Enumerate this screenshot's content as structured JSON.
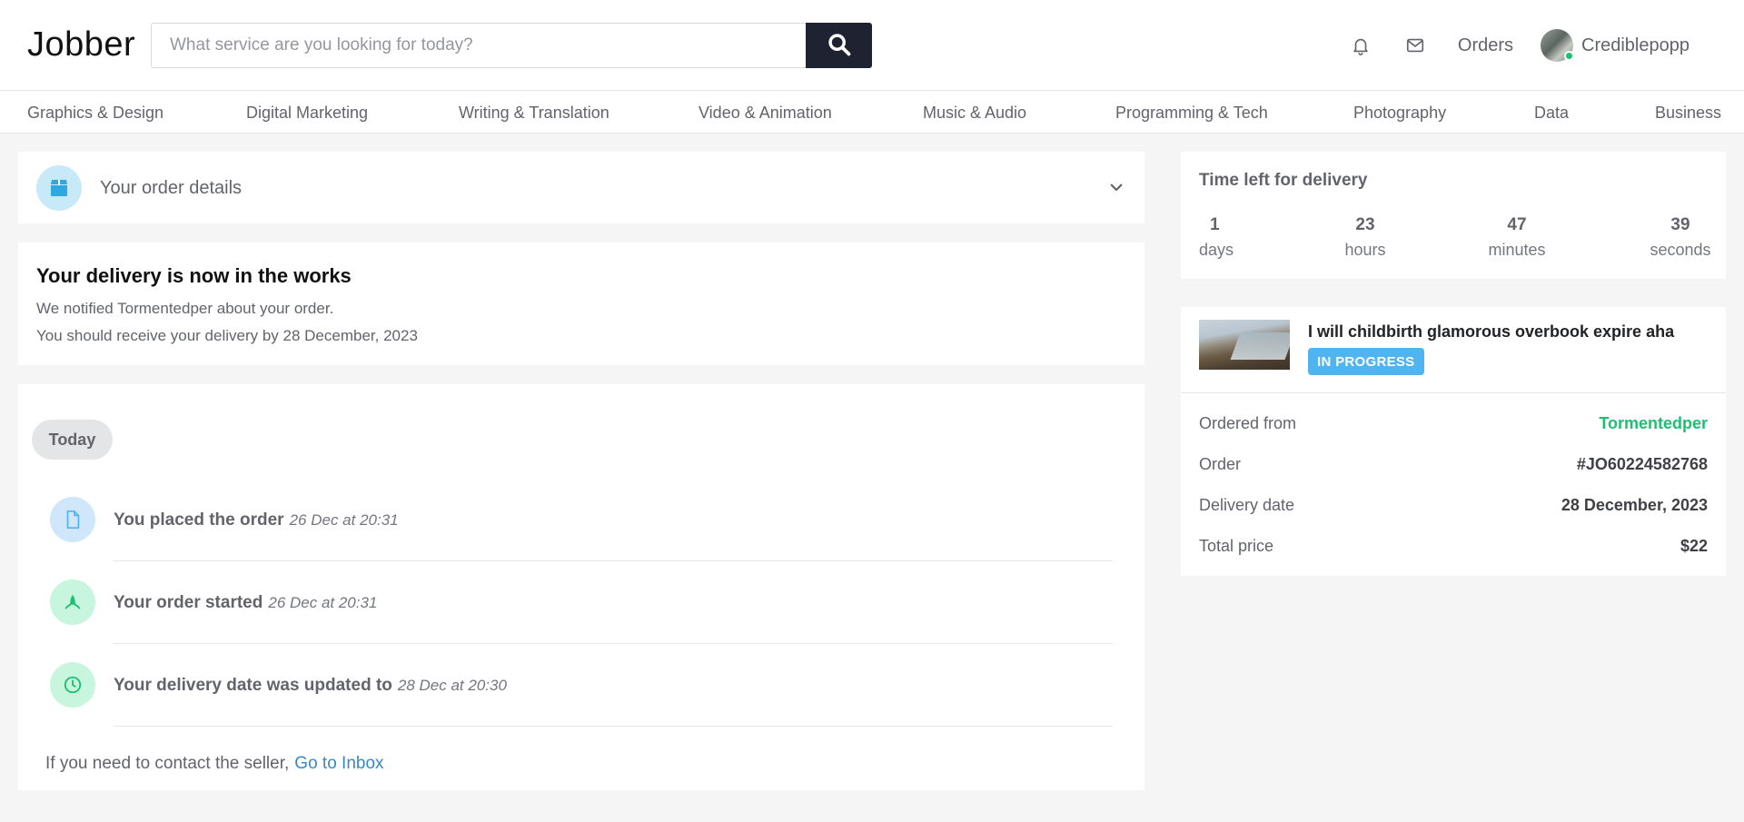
{
  "header": {
    "logo": "Jobber",
    "search_placeholder": "What service are you looking for today?",
    "orders_label": "Orders",
    "username": "Crediblepopp"
  },
  "categories": [
    "Graphics & Design",
    "Digital Marketing",
    "Writing & Translation",
    "Video & Animation",
    "Music & Audio",
    "Programming & Tech",
    "Photography",
    "Data",
    "Business"
  ],
  "order_details": {
    "title": "Your order details"
  },
  "works": {
    "title": "Your delivery is now in the works",
    "line1": "We notified Tormentedper about your order.",
    "line2": "You should receive your delivery by 28 December, 2023"
  },
  "timeline": {
    "day_label": "Today",
    "items": [
      {
        "label": "You placed the order",
        "time": "26 Dec at 20:31",
        "icon": "document-icon",
        "icon_bg": "#cfe6fb",
        "icon_color": "#4fb4f0"
      },
      {
        "label": "Your order started",
        "time": "26 Dec at 20:31",
        "icon": "rocket-icon",
        "icon_bg": "#c8f5dd",
        "icon_color": "#1dbf73"
      },
      {
        "label": "Your delivery date was updated to",
        "time": "28 Dec at 20:30",
        "icon": "clock-icon",
        "icon_bg": "#c8f5dd",
        "icon_color": "#1dbf73"
      }
    ],
    "contact_text": "If you need to contact the seller,",
    "contact_link": "Go to Inbox"
  },
  "time_left": {
    "title": "Time left for delivery",
    "units": [
      {
        "value": "1",
        "label": "days"
      },
      {
        "value": "23",
        "label": "hours"
      },
      {
        "value": "47",
        "label": "minutes"
      },
      {
        "value": "39",
        "label": "seconds"
      }
    ]
  },
  "summary": {
    "gig_title": "I will childbirth glamorous overbook expire aha",
    "status": "IN PROGRESS",
    "rows": [
      {
        "key": "Ordered from",
        "value": "Tormentedper"
      },
      {
        "key": "Order",
        "value": "#JO60224582768"
      },
      {
        "key": "Delivery date",
        "value": "28 December, 2023"
      },
      {
        "key": "Total price",
        "value": "$22"
      }
    ]
  },
  "colors": {
    "accent_green": "#1dbf73",
    "accent_blue": "#4fb4f0",
    "link_blue": "#3a87c8",
    "search_button": "#1f2230"
  }
}
